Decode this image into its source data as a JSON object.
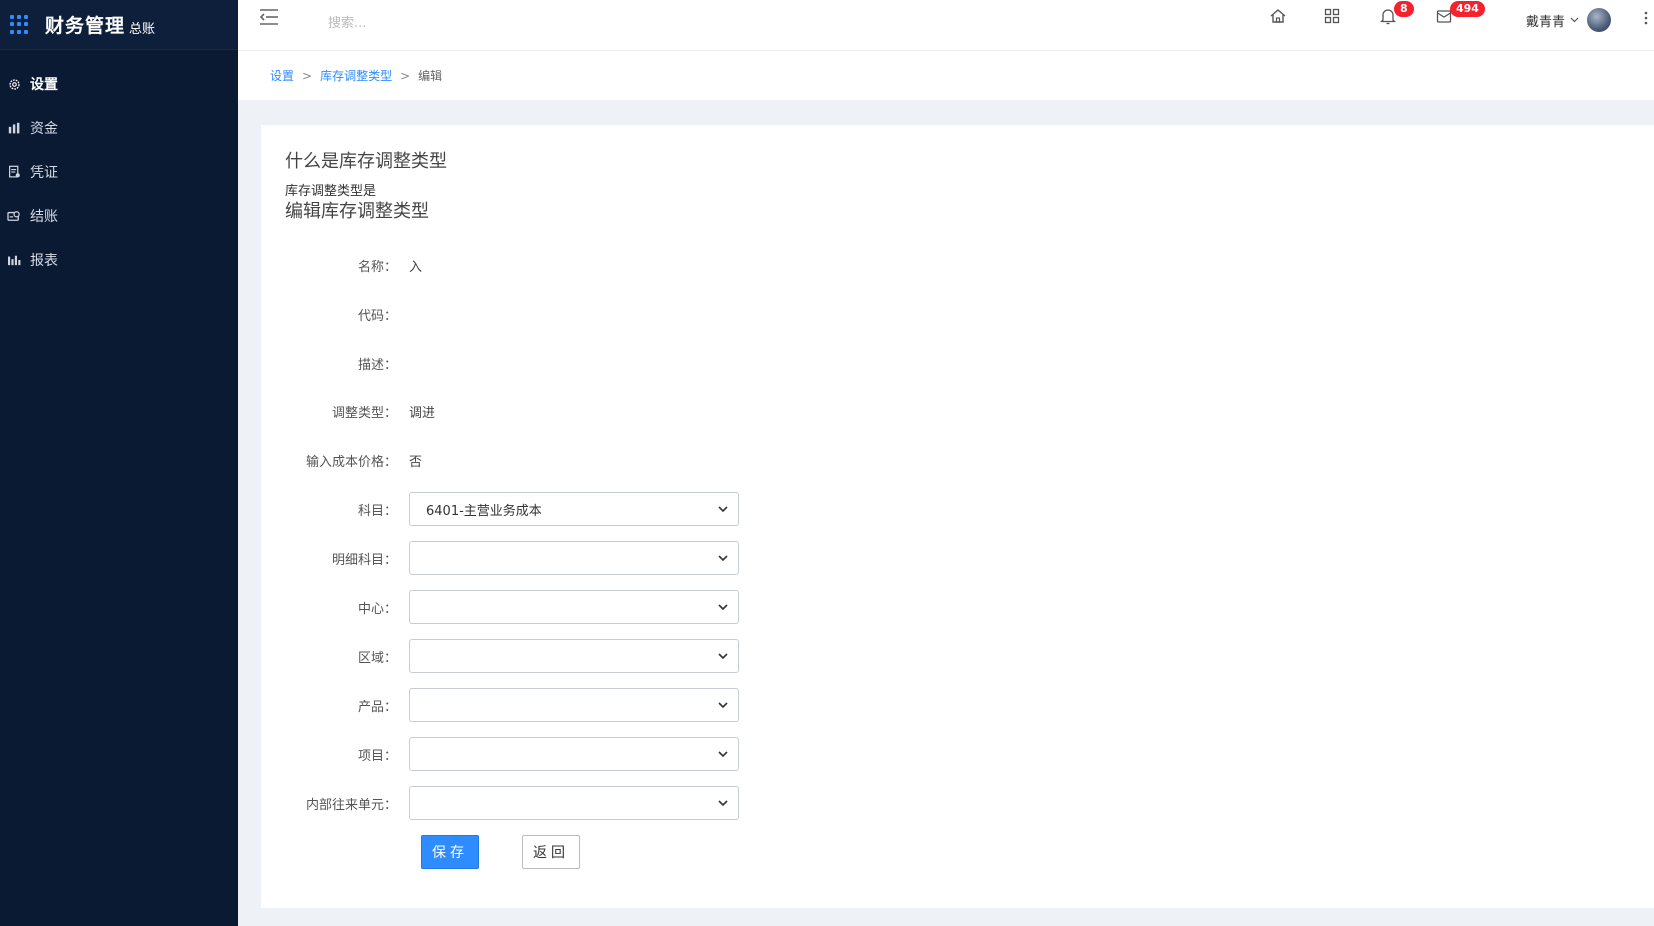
{
  "brand": {
    "title": "财务管理",
    "subtitle": "总账"
  },
  "sidebar": {
    "items": [
      {
        "label": "设置",
        "icon": "gear-icon"
      },
      {
        "label": "资金",
        "icon": "money-icon"
      },
      {
        "label": "凭证",
        "icon": "voucher-icon"
      },
      {
        "label": "结账",
        "icon": "checkout-icon"
      },
      {
        "label": "报表",
        "icon": "bar-chart-icon"
      }
    ],
    "active": "设置"
  },
  "header": {
    "search_placeholder": "搜索...",
    "notifications_count": "8",
    "messages_count": "494",
    "user_name": "戴青青"
  },
  "breadcrumb": {
    "item1": "设置",
    "item2": "库存调整类型",
    "current": "编辑",
    "sep": ">"
  },
  "page": {
    "question": "什么是库存调整类型",
    "description": "库存调整类型是",
    "edit_title": "编辑库存调整类型"
  },
  "form": {
    "name": {
      "label": "名称：",
      "value": "入"
    },
    "code": {
      "label": "代码：",
      "value": ""
    },
    "desc": {
      "label": "描述：",
      "value": ""
    },
    "adjust_type": {
      "label": "调整类型：",
      "value": "调进"
    },
    "input_cost": {
      "label": "输入成本价格：",
      "value": "否"
    },
    "account": {
      "label": "科目：",
      "value": "6401-主营业务成本"
    },
    "detail_account": {
      "label": "明细科目：",
      "value": ""
    },
    "center": {
      "label": "中心：",
      "value": ""
    },
    "region": {
      "label": "区域：",
      "value": ""
    },
    "product": {
      "label": "产品：",
      "value": ""
    },
    "project": {
      "label": "项目：",
      "value": ""
    },
    "internal_unit": {
      "label": "内部往来单元：",
      "value": ""
    },
    "save_label": "保存",
    "back_label": "返回"
  },
  "colors": {
    "sidebar_bg": "#0b1a33",
    "accent": "#2f8cff",
    "badge": "#f5222d"
  }
}
